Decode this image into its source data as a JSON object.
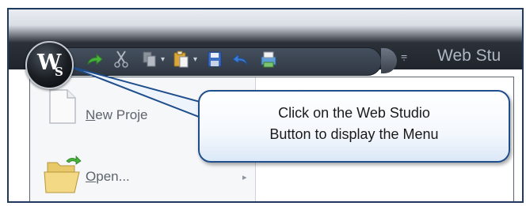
{
  "window": {
    "title": "Web Stu",
    "app_button_label": "W",
    "app_button_sub": "S"
  },
  "quick_access": {
    "items": [
      {
        "name": "redo-icon"
      },
      {
        "name": "cut-icon"
      },
      {
        "name": "copy-icon"
      },
      {
        "name": "paste-icon"
      },
      {
        "name": "save-icon"
      },
      {
        "name": "undo-icon"
      },
      {
        "name": "print-icon"
      }
    ],
    "customize_glyph": "⩦"
  },
  "menu": {
    "items": [
      {
        "label_underlined": "N",
        "label_rest": "ew Proje",
        "icon": "new-document-icon"
      },
      {
        "label_underlined": "O",
        "label_rest": "pen...",
        "icon": "open-folder-icon"
      }
    ]
  },
  "callout": {
    "line1": "Click on the Web Studio",
    "line2": "Button to display the Menu"
  },
  "colors": {
    "frame_border": "#1f3a5f",
    "callout_border": "#1f4e8c",
    "titlebar_dark": "#20242b"
  }
}
